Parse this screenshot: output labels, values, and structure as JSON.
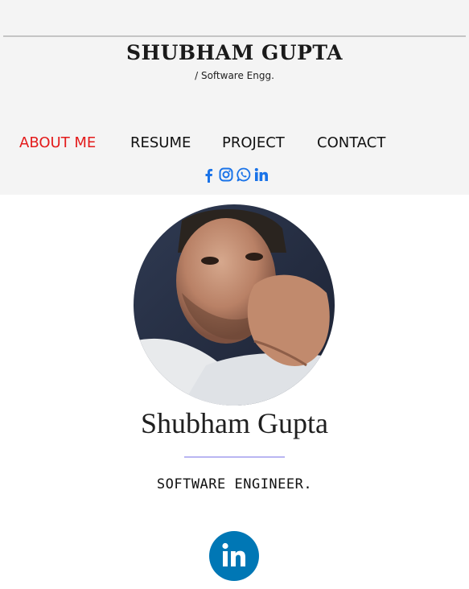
{
  "header": {
    "brand": "SHUBHAM GUPTA",
    "tagline": "/ Software Engg."
  },
  "nav": {
    "items": [
      {
        "label": "ABOUT ME",
        "active": true
      },
      {
        "label": "RESUME",
        "active": false
      },
      {
        "label": "PROJECT",
        "active": false
      },
      {
        "label": "CONTACT",
        "active": false
      }
    ],
    "active_color": "#e31b1b"
  },
  "socials": {
    "icons": [
      "facebook-icon",
      "instagram-icon",
      "whatsapp-icon",
      "linkedin-icon"
    ],
    "color": "#1a73e8"
  },
  "profile": {
    "name": "Shubham Gupta",
    "title": "SOFTWARE ENGINEER.",
    "divider_color": "#b9b6f2",
    "linkedin_badge_text": "in",
    "linkedin_color": "#0077b5"
  }
}
